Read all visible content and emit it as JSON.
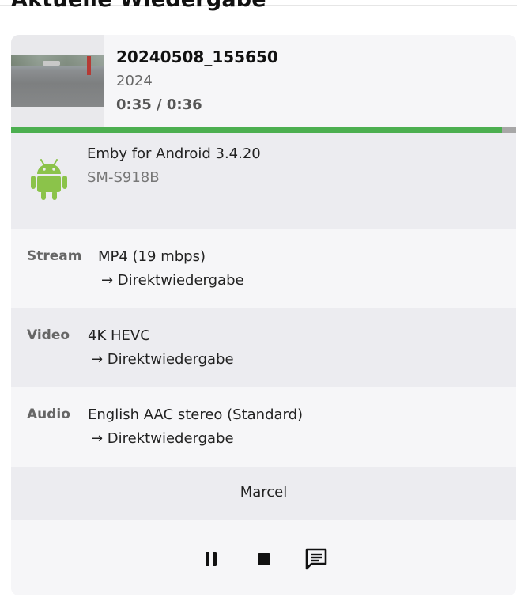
{
  "page": {
    "heading": "Aktuelle Wiedergabe"
  },
  "now_playing": {
    "title": "20240508_155650",
    "year": "2024",
    "time": "0:35 / 0:36",
    "progress_fraction": 0.972
  },
  "client": {
    "name": "Emby for Android 3.4.20",
    "device": "SM-S918B",
    "icon": "android-icon"
  },
  "stream": {
    "label": "Stream",
    "value": "MP4 (19 mbps)",
    "sub": "→  Direktwiedergabe"
  },
  "video": {
    "label": "Video",
    "value": "4K HEVC",
    "sub": "→  Direktwiedergabe"
  },
  "audio": {
    "label": "Audio",
    "value": "English AAC stereo (Standard)",
    "sub": "→  Direktwiedergabe"
  },
  "user": {
    "name": "Marcel"
  },
  "controls": {
    "icons": [
      "pause-icon",
      "stop-icon",
      "message-icon"
    ]
  },
  "colors": {
    "progress": "#4caf50",
    "progress_track": "#a7a7a7",
    "android": "#8bc34a"
  }
}
